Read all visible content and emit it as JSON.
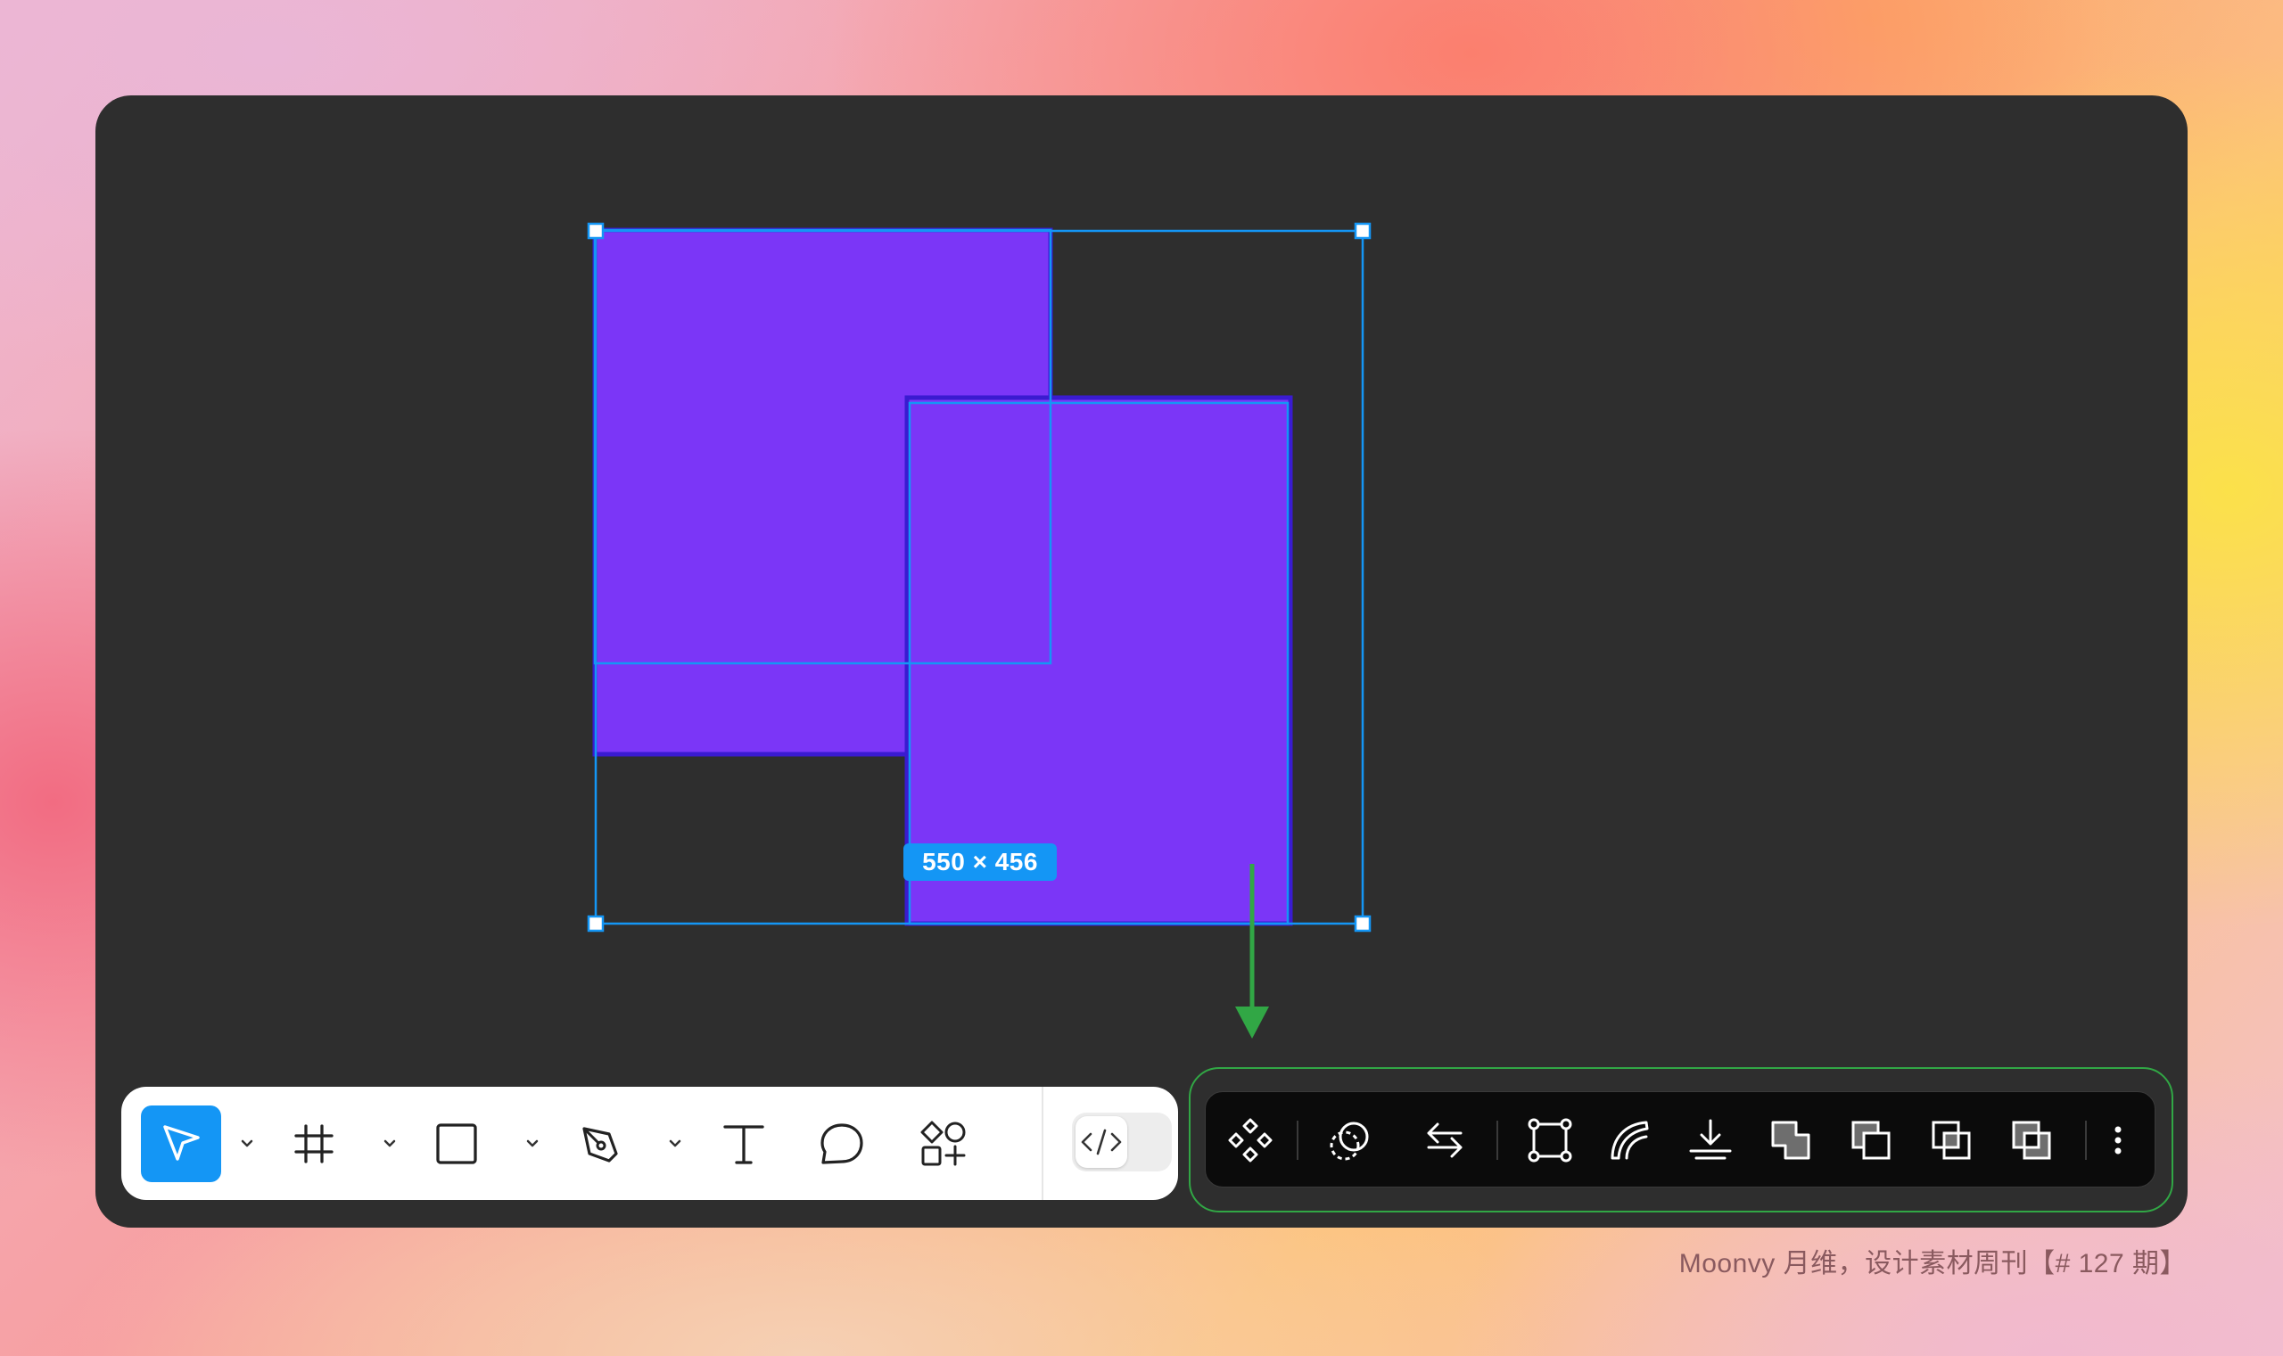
{
  "canvas": {
    "selection_size": "550 × 456",
    "shape_fill": "#7b36f7",
    "selection_color": "#1496f5",
    "background": "#2e2e2e"
  },
  "annotation": {
    "highlight_color": "#31a745"
  },
  "main_toolbar": {
    "tools": [
      {
        "name": "move-tool",
        "icon": "pointer-icon",
        "active": true,
        "has_menu": true
      },
      {
        "name": "frame-tool",
        "icon": "frame-hash-icon",
        "active": false,
        "has_menu": true
      },
      {
        "name": "rectangle-tool",
        "icon": "rectangle-icon",
        "active": false,
        "has_menu": true
      },
      {
        "name": "pen-tool",
        "icon": "pen-nib-icon",
        "active": false,
        "has_menu": true
      },
      {
        "name": "text-tool",
        "icon": "text-t-icon",
        "active": false,
        "has_menu": false
      },
      {
        "name": "comment-tool",
        "icon": "comment-bubble-icon",
        "active": false,
        "has_menu": false
      },
      {
        "name": "resources-tool",
        "icon": "shapes-plus-icon",
        "active": false,
        "has_menu": false
      }
    ],
    "dev_mode_icon": "code-brackets-icon",
    "dev_mode_on": false
  },
  "contextual_toolbar": {
    "actions": [
      {
        "name": "create-component",
        "icon": "component-icon"
      },
      {
        "name": "mask",
        "icon": "mask-icon"
      },
      {
        "name": "swap",
        "icon": "swap-arrows-icon"
      },
      {
        "name": "edit-object",
        "icon": "vector-edit-icon"
      },
      {
        "name": "outline-stroke",
        "icon": "outline-stroke-icon"
      },
      {
        "name": "flatten",
        "icon": "flatten-icon"
      },
      {
        "name": "union",
        "icon": "boolean-union-icon"
      },
      {
        "name": "subtract",
        "icon": "boolean-subtract-icon"
      },
      {
        "name": "intersect",
        "icon": "boolean-intersect-icon"
      },
      {
        "name": "exclude",
        "icon": "boolean-exclude-icon"
      },
      {
        "name": "more-options",
        "icon": "more-vertical-icon"
      }
    ]
  },
  "watermark": {
    "text": "Moonvy 月维，设计素材周刊【# 127 期】"
  }
}
